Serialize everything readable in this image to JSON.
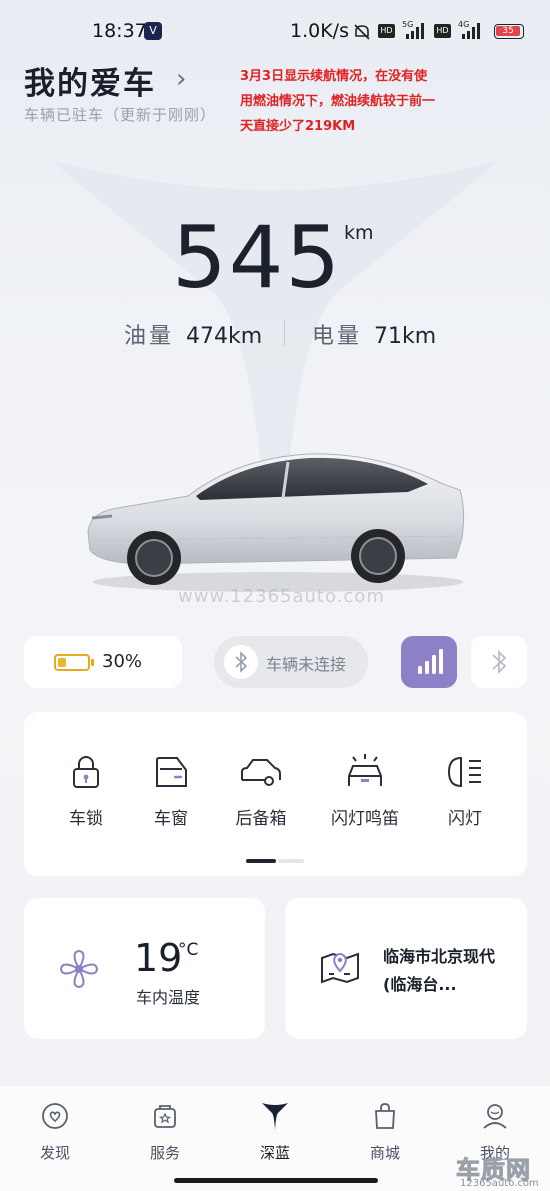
{
  "status_bar": {
    "time": "18:37",
    "net_speed": "1.0K/s",
    "app_badge": "V",
    "hd1": "HD",
    "sim1": "5G",
    "hd2": "HD",
    "sim2": "4G",
    "battery": "35"
  },
  "header": {
    "title": "我的爱车",
    "subtitle": "车辆已驻车（更新于刚刚）"
  },
  "annotation": "3月3日显示续航情况，在没有使用燃油情况下，燃油续航较于前一天直接少了219KM",
  "range": {
    "total": "545",
    "unit": "km",
    "fuel_label": "油量",
    "fuel_value": "474km",
    "electric_label": "电量",
    "electric_value": "71km"
  },
  "watermark": "www.12365auto.com",
  "status_chips": {
    "battery_percent": "30%",
    "battery_level": 0.3,
    "connection_label": "车辆未连接"
  },
  "quick_actions": [
    {
      "label": "车锁",
      "icon": "lock-icon"
    },
    {
      "label": "车窗",
      "icon": "car-window-icon"
    },
    {
      "label": "后备箱",
      "icon": "trunk-icon"
    },
    {
      "label": "闪灯鸣笛",
      "icon": "flash-horn-icon"
    },
    {
      "label": "闪灯",
      "icon": "headlight-icon"
    }
  ],
  "climate": {
    "temperature": "19",
    "unit": "°C",
    "label": "车内温度"
  },
  "location": {
    "text": "临海市北京现代(临海台..."
  },
  "tabs": [
    {
      "label": "发现",
      "icon": "discover-icon"
    },
    {
      "label": "服务",
      "icon": "service-icon"
    },
    {
      "label": "深蓝",
      "icon": "deepal-logo-icon"
    },
    {
      "label": "商城",
      "icon": "shop-bag-icon"
    },
    {
      "label": "我的",
      "icon": "profile-icon"
    }
  ],
  "brand": {
    "name": "车质网",
    "url": "12365auto.com"
  },
  "colors": {
    "accent_purple": "#8e80c6",
    "battery_orange": "#f0b429",
    "annotation_red": "#e02222"
  }
}
